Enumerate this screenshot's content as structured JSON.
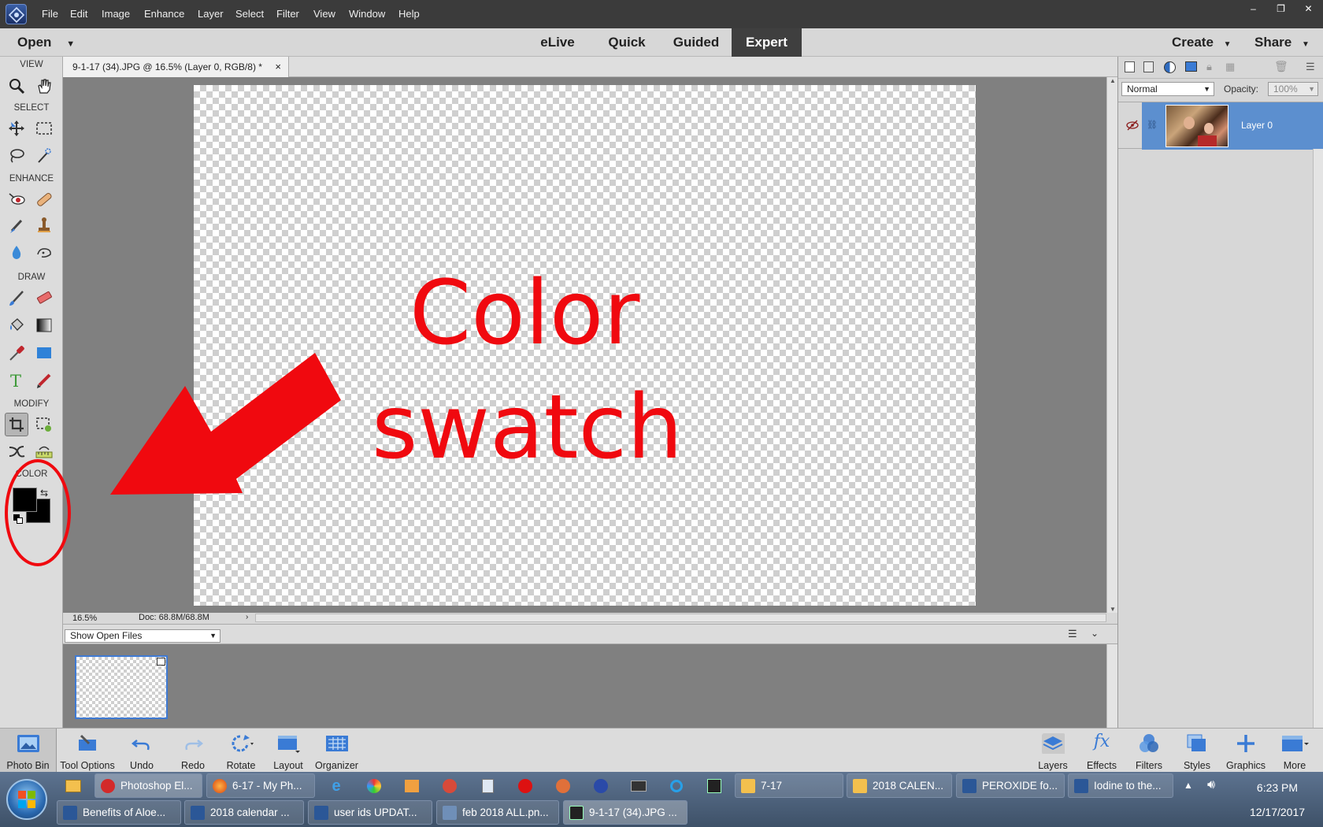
{
  "menu": [
    "File",
    "Edit",
    "Image",
    "Enhance",
    "Layer",
    "Select",
    "Filter",
    "View",
    "Window",
    "Help"
  ],
  "window_controls": [
    "–",
    "❐",
    "✕"
  ],
  "modebar": {
    "open_label": "Open",
    "modes": [
      "eLive",
      "Quick",
      "Guided",
      "Expert"
    ],
    "active_mode": "Expert",
    "create_label": "Create",
    "share_label": "Share"
  },
  "toolbox": {
    "sections": [
      "VIEW",
      "SELECT",
      "ENHANCE",
      "DRAW",
      "MODIFY",
      "COLOR"
    ],
    "foreground_color": "#000000",
    "background_color": "#000000"
  },
  "document": {
    "tab_title": "9-1-17 (34).JPG @ 16.5% (Layer 0, RGB/8) *",
    "close_glyph": "×",
    "zoom": "16.5%",
    "doc_size": "Doc: 68.8M/68.8M"
  },
  "bin": {
    "show_select": "Show Open Files"
  },
  "layers": {
    "blend_mode": "Normal",
    "opacity_label": "Opacity:",
    "opacity_value": "100%",
    "layer_name": "Layer 0"
  },
  "app_buttons_left": [
    "Photo Bin",
    "Tool Options",
    "Undo",
    "Redo",
    "Rotate",
    "Layout",
    "Organizer"
  ],
  "app_buttons_right": [
    "Layers",
    "Effects",
    "Filters",
    "Styles",
    "Graphics",
    "More"
  ],
  "taskbar": {
    "row1": [
      "Photoshop El...",
      "6-17 - My Ph...",
      "7-17",
      "2018 CALEN...",
      "PEROXIDE fo...",
      "Iodine to the..."
    ],
    "row2": [
      "Benefits of Aloe...",
      "2018 calendar ...",
      "user ids UPDAT...",
      "feb 2018 ALL.pn...",
      "9-1-17 (34).JPG ..."
    ],
    "time": "6:23 PM",
    "date": "12/17/2017"
  },
  "annotation": {
    "line1": "Color",
    "line2": "swatch",
    "color": "#f0090f"
  }
}
